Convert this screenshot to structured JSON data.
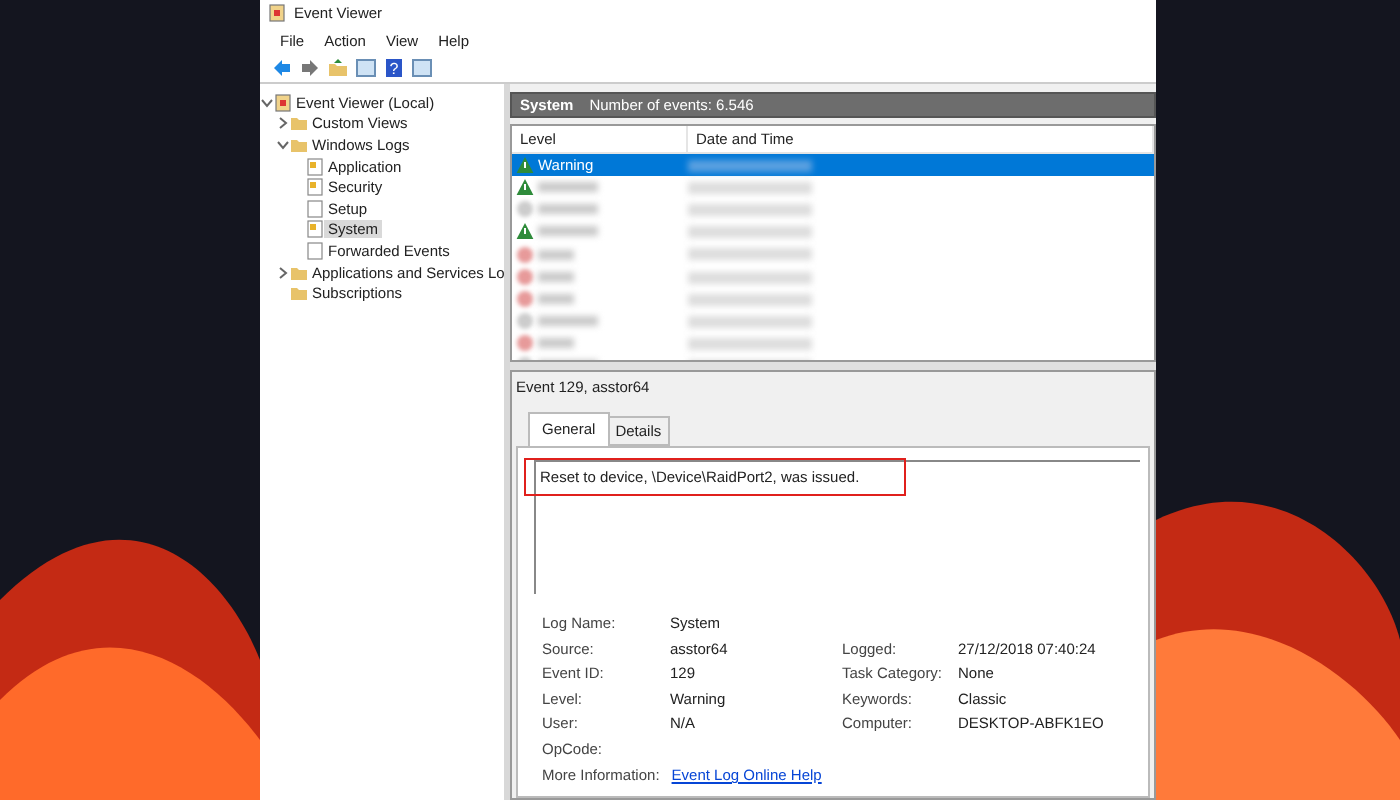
{
  "window": {
    "title": "Event Viewer"
  },
  "menu": [
    "File",
    "Action",
    "View",
    "Help"
  ],
  "toolbar": {
    "help_glyph": "?"
  },
  "tree": [
    {
      "label": "Event Viewer (Local)",
      "kind": "viewer",
      "expanded": true,
      "selected": false,
      "children": [
        {
          "label": "Custom Views",
          "kind": "folder",
          "expanded": false,
          "selected": false
        },
        {
          "label": "Windows Logs",
          "kind": "folder",
          "expanded": true,
          "selected": false,
          "children": [
            {
              "label": "Application",
              "kind": "log",
              "selected": false
            },
            {
              "label": "Security",
              "kind": "log",
              "selected": false
            },
            {
              "label": "Setup",
              "kind": "empty",
              "selected": false
            },
            {
              "label": "System",
              "kind": "log",
              "selected": true
            },
            {
              "label": "Forwarded Events",
              "kind": "empty",
              "selected": false
            }
          ]
        },
        {
          "label": "Applications and Services Lo",
          "kind": "folder",
          "expanded": false,
          "selected": false
        },
        {
          "label": "Subscriptions",
          "kind": "folder",
          "selected": false
        }
      ]
    }
  ],
  "log_header": {
    "name": "System",
    "count": "Number of events: 6.546"
  },
  "table": {
    "columns": [
      "Level",
      "Date and Time"
    ],
    "rows": [
      {
        "level": "Warning",
        "kind": "warning",
        "blurred": false,
        "selected": true
      },
      {
        "kind": "warning",
        "blurred": true,
        "selected": false
      },
      {
        "kind": "info",
        "blurred": true,
        "selected": false
      },
      {
        "kind": "warning",
        "blurred": true,
        "selected": false
      },
      {
        "kind": "error",
        "blurred": true,
        "selected": false
      },
      {
        "kind": "error",
        "blurred": true,
        "selected": false
      },
      {
        "kind": "error",
        "blurred": true,
        "selected": false
      },
      {
        "kind": "info",
        "blurred": true,
        "selected": false
      },
      {
        "kind": "error",
        "blurred": true,
        "selected": false
      },
      {
        "kind": "info",
        "blurred": true,
        "selected": false
      }
    ]
  },
  "event": {
    "title": "Event 129, asstor64",
    "tabs": [
      {
        "label": "General",
        "selected": true
      },
      {
        "label": "Details",
        "selected": false
      }
    ],
    "message": "Reset to device, \\Device\\RaidPort2, was issued.",
    "message_highlighted": true,
    "fields_left": [
      {
        "label": "Log Name:",
        "value": "System"
      },
      {
        "label": "Source:",
        "value": "asstor64"
      },
      {
        "label": "Event ID:",
        "value": "129"
      },
      {
        "label": "Level:",
        "value": "Warning"
      },
      {
        "label": "User:",
        "value": "N/A"
      },
      {
        "label": "OpCode:"
      }
    ],
    "fields_right": [
      {
        "label": "Logged:",
        "value": "27/12/2018 07:40:24"
      },
      {
        "label": "Task Category:",
        "value": "None"
      },
      {
        "label": "Keywords:",
        "value": "Classic"
      },
      {
        "label": "Computer:",
        "value": "DESKTOP-ABFK1EO"
      }
    ],
    "more_info": {
      "label": "More Information:",
      "link": "Event Log Online Help"
    }
  }
}
